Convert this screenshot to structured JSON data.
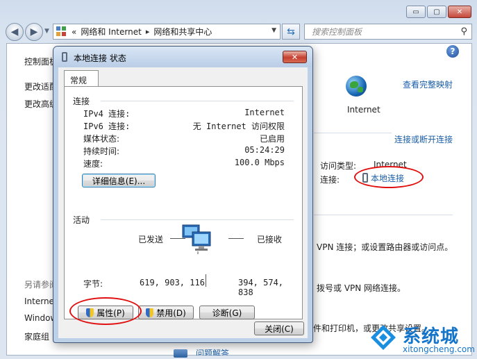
{
  "window": {
    "caption": {
      "minimize": "▭",
      "maximize": "▢",
      "close": "✕"
    }
  },
  "nav": {
    "back_icon": "back-arrow-icon",
    "forward_icon": "forward-arrow-icon",
    "address": {
      "prefix": "«",
      "crumb_1": "网络和 Internet",
      "crumb_2": "网络和共享中心"
    },
    "search_placeholder": "搜索控制面板"
  },
  "left_pane": {
    "items": [
      "控制面板",
      "更改适配",
      "更改高级"
    ],
    "see_also_label": "另请参阅",
    "see_also_items": [
      "Internet",
      "Windows",
      "家庭组"
    ]
  },
  "main": {
    "view_full_map": "查看完整映射",
    "internet_label": "Internet",
    "connect_disconnect": "连接或断开连接",
    "access_type_label": "访问类型:",
    "access_type_value": "Internet",
    "connections_label": "连接:",
    "connections_value": "本地连接",
    "vpn_text": "VPN 连接；或设置路由器或访问点。",
    "dialup_text": "拨号或 VPN 网络连接。",
    "printer_text": "件和打印机，或更改共享设置。",
    "troubleshoot_text": "问题解答"
  },
  "dialog": {
    "title": "本地连接 状态",
    "close_glyph": "✕",
    "tab": "常规",
    "connection": {
      "header": "连接",
      "rows": [
        {
          "key": "IPv4 连接:",
          "value": "Internet"
        },
        {
          "key": "IPv6 连接:",
          "value": "无 Internet 访问权限"
        },
        {
          "key": "媒体状态:",
          "value": "已启用"
        },
        {
          "key": "持续时间:",
          "value": "05:24:29"
        },
        {
          "key": "速度:",
          "value": "100.0 Mbps"
        }
      ],
      "details_button": "详细信息(E)..."
    },
    "activity": {
      "header": "活动",
      "sent_label": "已发送",
      "received_label": "已接收",
      "bytes_label": "字节:",
      "bytes_sent": "619, 903, 116",
      "bytes_received": "394, 574, 838"
    },
    "buttons": {
      "properties": "属性(P)",
      "disable": "禁用(D)",
      "diagnose": "诊断(G)",
      "close": "关闭(C)"
    }
  },
  "watermark": {
    "brand": "系统城",
    "site": "xitongcheng.com"
  },
  "colors": {
    "link": "#1a5ea8",
    "annotation": "#e01010",
    "watermark": "#1474c9"
  }
}
